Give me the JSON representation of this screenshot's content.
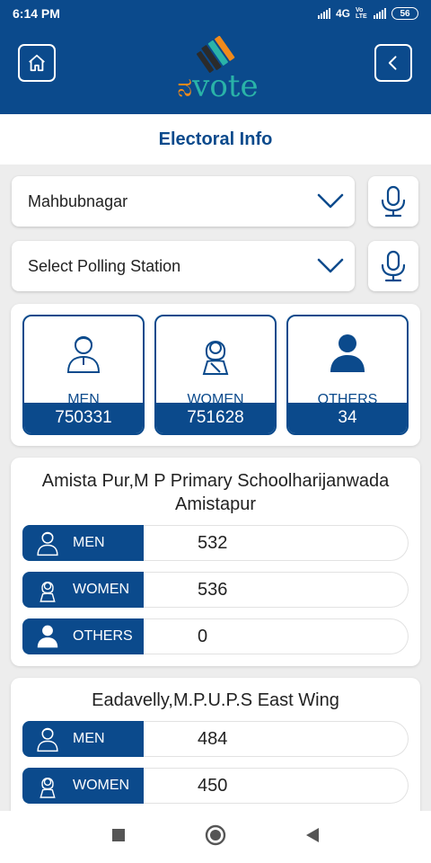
{
  "status": {
    "time": "6:14 PM",
    "network": "4G",
    "carrier": "Vo LTE",
    "battery": "56"
  },
  "header": {
    "logo_text": "vote",
    "logo_prefix": "ನ"
  },
  "page": {
    "title": "Electoral Info"
  },
  "filters": {
    "district": "Mahbubnagar",
    "polling_station_placeholder": "Select Polling Station"
  },
  "summary": {
    "men": {
      "label": "MEN",
      "value": "750331"
    },
    "women": {
      "label": "WOMEN",
      "value": "751628"
    },
    "others": {
      "label": "OTHERS",
      "value": "34"
    }
  },
  "stations": [
    {
      "name": "Amista Pur,M P Primary Schoolharijanwada Amistapur",
      "men_label": "MEN",
      "men": "532",
      "women_label": "WOMEN",
      "women": "536",
      "others_label": "OTHERS",
      "others": "0"
    },
    {
      "name": "Eadavelly,M.P.U.P.S East Wing",
      "men_label": "MEN",
      "men": "484",
      "women_label": "WOMEN",
      "women": "450"
    }
  ],
  "colors": {
    "primary": "#0b4a8c",
    "accent": "#2ab3a8",
    "logo_orange": "#f08a1c",
    "background": "#ededed"
  },
  "icons": {
    "home": "home-icon",
    "back": "chevron-left-icon",
    "mic": "mic-icon",
    "dropdown": "chevron-down-icon",
    "men": "man-icon",
    "women": "woman-icon",
    "others": "person-icon"
  }
}
